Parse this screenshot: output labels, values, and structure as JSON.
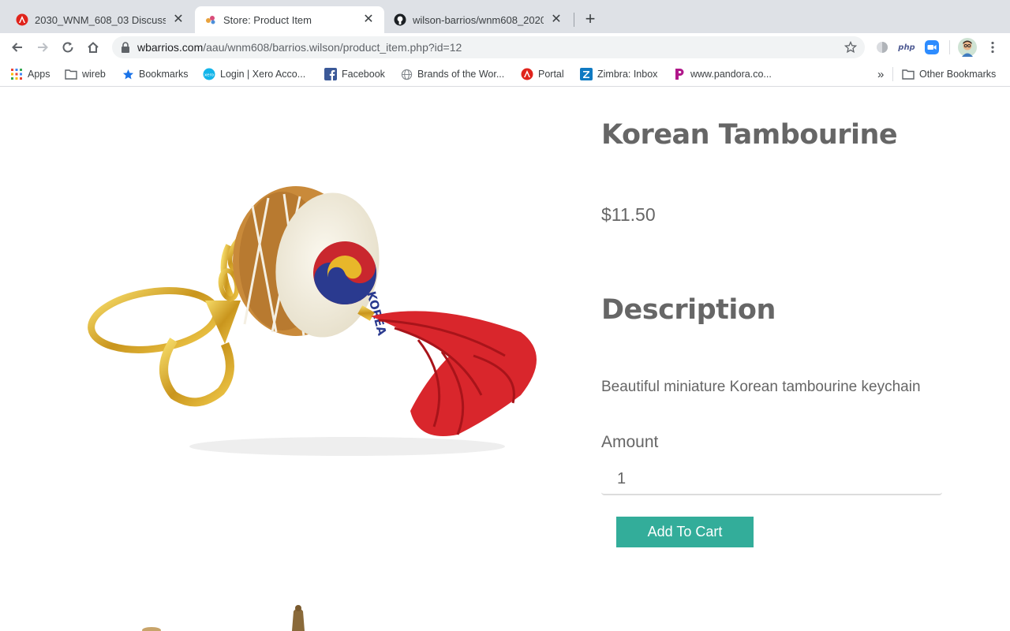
{
  "browser": {
    "tabs": [
      {
        "title": "2030_WNM_608_03 Discussion",
        "icon": "angular-red-icon",
        "active": false
      },
      {
        "title": "Store: Product Item",
        "icon": "store-favicon-icon",
        "active": true
      },
      {
        "title": "wilson-barrios/wnm608_2020",
        "icon": "github-icon",
        "active": false
      }
    ],
    "url": {
      "host": "wbarrios.com",
      "path": "/aau/wnm608/barrios.wilson/product_item.php?id=12"
    },
    "extensions": [
      "gray-circle-icon",
      "php-icon",
      "zoom-icon",
      "avatar"
    ],
    "bookmarks": [
      {
        "label": "Apps",
        "icon": "apps-grid-icon"
      },
      {
        "label": "wireb",
        "icon": "folder-icon"
      },
      {
        "label": "Bookmarks",
        "icon": "star-blue-icon"
      },
      {
        "label": "Login | Xero Acco...",
        "icon": "xero-icon"
      },
      {
        "label": "Facebook",
        "icon": "facebook-icon"
      },
      {
        "label": "Brands of the Wor...",
        "icon": "globe-icon"
      },
      {
        "label": "Portal",
        "icon": "angular-red-icon"
      },
      {
        "label": "Zimbra: Inbox",
        "icon": "zimbra-icon"
      },
      {
        "label": "www.pandora.co...",
        "icon": "pandora-icon"
      }
    ],
    "other_bookmarks": "Other Bookmarks",
    "overflow": "»"
  },
  "product": {
    "title": "Korean Tambourine",
    "price": "$11.50",
    "description_heading": "Description",
    "description": "Beautiful miniature Korean tambourine keychain",
    "amount_label": "Amount",
    "amount_value": "1",
    "add_to_cart_label": "Add To Cart",
    "image_text": "KOREA",
    "accent_color": "#33ad9a"
  }
}
